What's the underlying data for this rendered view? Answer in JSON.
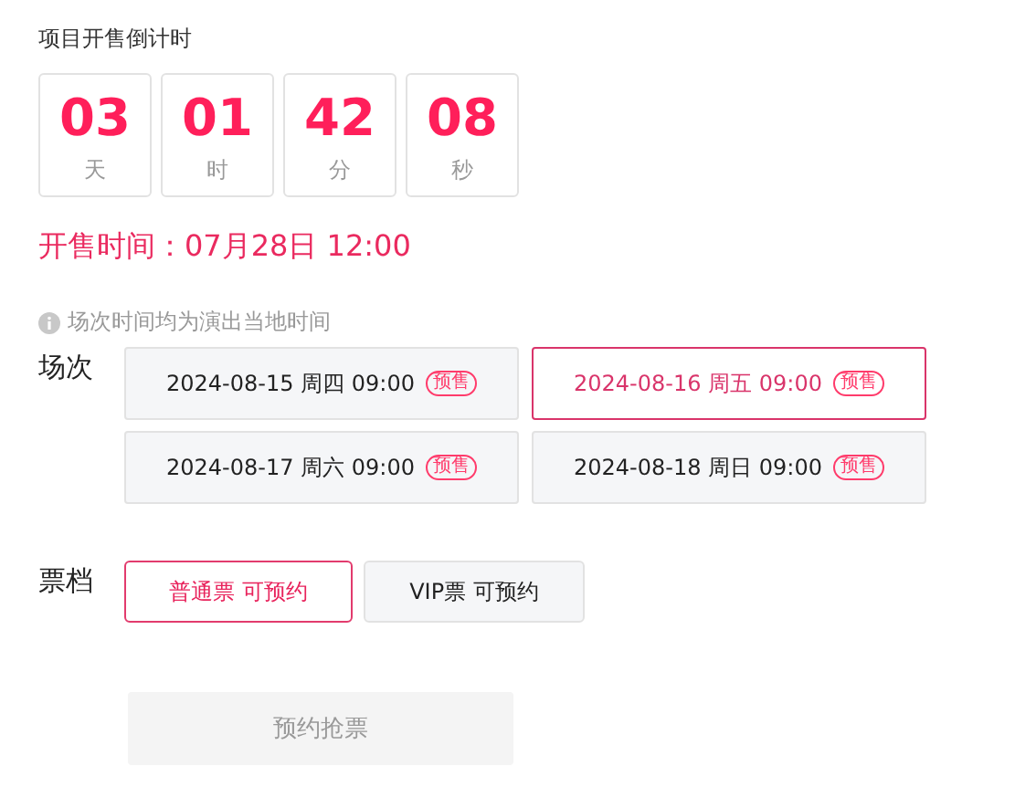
{
  "countdown": {
    "title": "项目开售倒计时",
    "units": [
      {
        "value": "03",
        "unit": "天"
      },
      {
        "value": "01",
        "unit": "时"
      },
      {
        "value": "42",
        "unit": "分"
      },
      {
        "value": "08",
        "unit": "秒"
      }
    ]
  },
  "sale_time": "开售时间：07月28日 12:00",
  "note": "场次时间均为演出当地时间",
  "sessions": {
    "label": "场次",
    "items": [
      {
        "text": "2024-08-15 周四 09:00",
        "badge": "预售",
        "selected": false
      },
      {
        "text": "2024-08-16 周五 09:00",
        "badge": "预售",
        "selected": true
      },
      {
        "text": "2024-08-17 周六 09:00",
        "badge": "预售",
        "selected": false
      },
      {
        "text": "2024-08-18 周日 09:00",
        "badge": "预售",
        "selected": false
      }
    ]
  },
  "tickets": {
    "label": "票档",
    "items": [
      {
        "text": "普通票 可预约",
        "selected": true
      },
      {
        "text": "VIP票 可预约",
        "selected": false
      }
    ]
  },
  "submit": {
    "label": "预约抢票",
    "disabled": true
  }
}
